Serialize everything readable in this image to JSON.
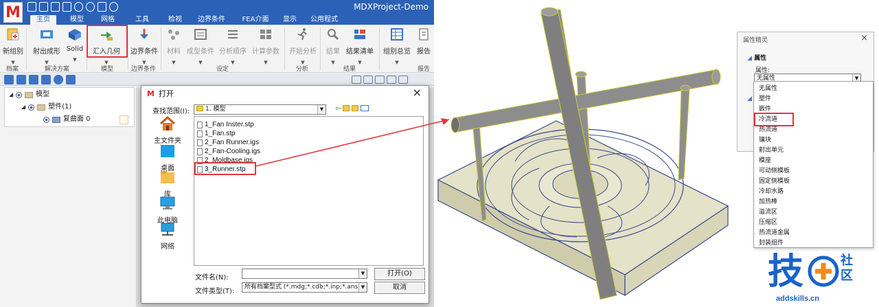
{
  "app": {
    "logo_letter": "M",
    "title": "MDXProject-Demo",
    "tabs": [
      "主页",
      "模型",
      "网格",
      "工具",
      "检视",
      "边界条件",
      "FEA介面",
      "显示",
      "公用程式"
    ],
    "active_tab": "主页"
  },
  "ribbon": {
    "buttons": [
      {
        "label": "新组别"
      },
      {
        "label": "射出成形"
      },
      {
        "label": "Solid"
      },
      {
        "label": "汇入几何"
      },
      {
        "label": "边界条件"
      },
      {
        "label": "材料"
      },
      {
        "label": "成型条件"
      },
      {
        "label": "分析顺序"
      },
      {
        "label": "计算参数"
      },
      {
        "label": "开始分析"
      },
      {
        "label": "结果"
      },
      {
        "label": "结果清单"
      },
      {
        "label": "组别总览"
      },
      {
        "label": "报告"
      }
    ],
    "groups": [
      "档案",
      "解决方案",
      "模型",
      "边界条件",
      "设定",
      "分析",
      "结果",
      "报告"
    ]
  },
  "tree": {
    "root": "模型",
    "child": "塑件(1)",
    "leaf": "复曲面 0"
  },
  "dialog": {
    "title": "打开",
    "lookin_label": "查找范围(I):",
    "lookin_value": "1. 模型",
    "places": [
      "主文件夹",
      "桌面",
      "库",
      "此电脑",
      "网络"
    ],
    "files": [
      "1_Fan Inster.stp",
      "1_Fan.stp",
      "2_Fan Runner.igs",
      "2_Fan-Cooling.igs",
      "2_Moldbase.igs",
      "3_Runner.stp"
    ],
    "filename_label": "文件名(N):",
    "filename_value": "",
    "filetype_label": "文件类型(T):",
    "filetype_value": "所有档案型式 (*.mdg;*.cdb;*.inp;*.ans",
    "open_button": "打开(O)",
    "cancel_button": "取消"
  },
  "properties": {
    "panel_title": "属性精灵",
    "section": "属性",
    "field_label": "属性:",
    "field_value": "无属性",
    "options": [
      "无属性",
      "塑件",
      "嵌件",
      "冷流道",
      "热流道",
      "镶块",
      "射出单元",
      "模座",
      "可动侧模板",
      "固定侧模板",
      "冷却水路",
      "加热棒",
      "溢流区",
      "压缩区",
      "热流道金属",
      "封装组件"
    ],
    "highlighted_option": "冷流道"
  },
  "brand": {
    "char": "技",
    "side_text": [
      "社",
      "区"
    ],
    "url": "addskills.cn"
  },
  "colors": {
    "titlebar": "#2b62b8",
    "highlight_red": "#e0373d",
    "model_body": "#e4e2c8",
    "model_edge": "#3a4a8c",
    "runner_gray": "#8d8d8d",
    "brand_blue": "#1b63c6",
    "brand_orange": "#f08a1e"
  }
}
